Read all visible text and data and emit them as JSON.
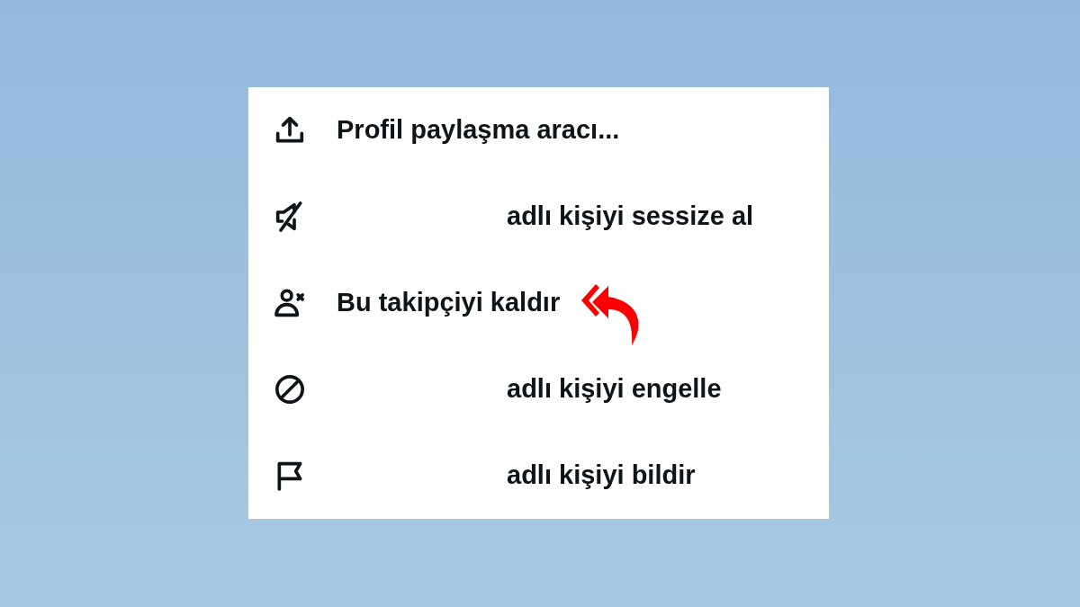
{
  "menu": {
    "items": [
      {
        "label": "Profil paylaşma aracı...",
        "kind": "plain",
        "highlighted": false
      },
      {
        "label": "adlı kişiyi sessize al",
        "kind": "name_gap",
        "highlighted": false
      },
      {
        "label": "Bu takipçiyi kaldır",
        "kind": "plain",
        "highlighted": true
      },
      {
        "label": "adlı kişiyi engelle",
        "kind": "name_gap",
        "highlighted": false
      },
      {
        "label": "adlı kişiyi bildir",
        "kind": "name_gap",
        "highlighted": false
      }
    ]
  }
}
